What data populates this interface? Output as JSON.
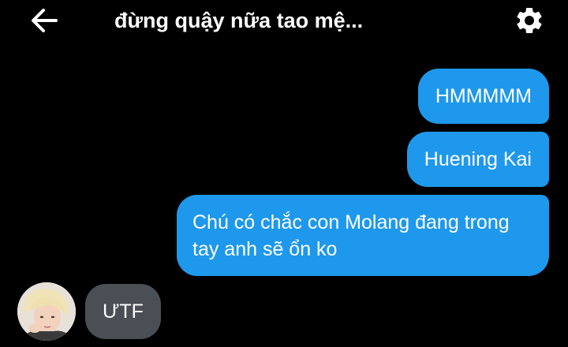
{
  "header": {
    "title": "đừng quậy nữa tao mệ...",
    "back_icon": "arrow-left-icon",
    "settings_icon": "gear-icon"
  },
  "messages": [
    {
      "direction": "outgoing",
      "text": "HMMMMM"
    },
    {
      "direction": "outgoing",
      "text": "Huening Kai"
    },
    {
      "direction": "outgoing",
      "text": "Chú có chắc con Molang đang trong tay anh sẽ ổn ko"
    },
    {
      "direction": "incoming",
      "text": "ƯTF"
    }
  ],
  "colors": {
    "background": "#000000",
    "outgoing_bubble": "#1e98ec",
    "incoming_bubble": "#4a4f55",
    "text": "#ffffff"
  }
}
